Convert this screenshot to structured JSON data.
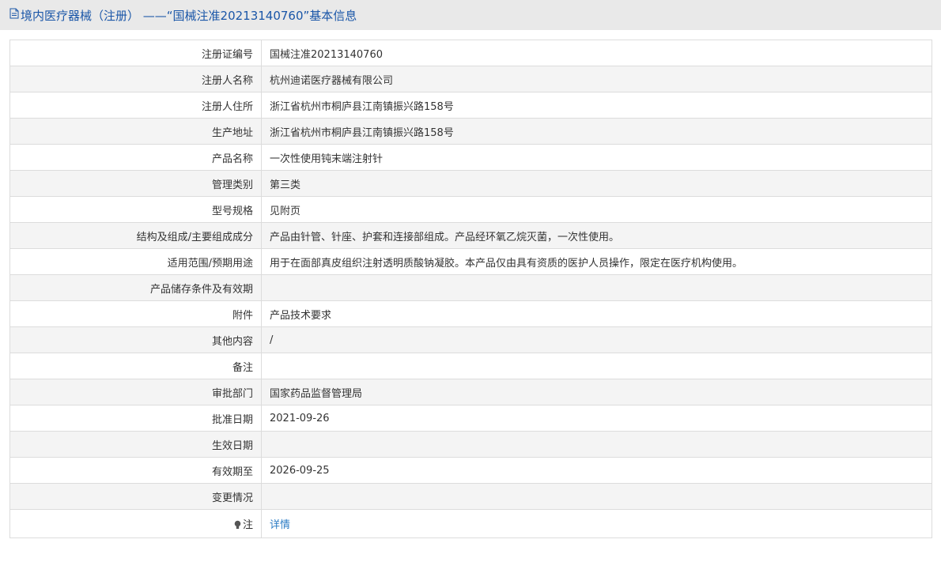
{
  "page": {
    "title": "境内医疗器械（注册） ——“国械注准20213140760”基本信息"
  },
  "rows": [
    {
      "label": "注册证编号",
      "value": "国械注准20213140760"
    },
    {
      "label": "注册人名称",
      "value": "杭州迪诺医疗器械有限公司"
    },
    {
      "label": "注册人住所",
      "value": "浙江省杭州市桐庐县江南镇振兴路158号"
    },
    {
      "label": "生产地址",
      "value": "浙江省杭州市桐庐县江南镇振兴路158号"
    },
    {
      "label": "产品名称",
      "value": "一次性使用钝末端注射针"
    },
    {
      "label": "管理类别",
      "value": "第三类"
    },
    {
      "label": "型号规格",
      "value": "见附页"
    },
    {
      "label": "结构及组成/主要组成成分",
      "value": "产品由针管、针座、护套和连接部组成。产品经环氧乙烷灭菌，一次性使用。"
    },
    {
      "label": "适用范围/预期用途",
      "value": "用于在面部真皮组织注射透明质酸钠凝胶。本产品仅由具有资质的医护人员操作，限定在医疗机构使用。"
    },
    {
      "label": "产品储存条件及有效期",
      "value": ""
    },
    {
      "label": "附件",
      "value": "产品技术要求"
    },
    {
      "label": "其他内容",
      "value": "/"
    },
    {
      "label": "备注",
      "value": ""
    },
    {
      "label": "审批部门",
      "value": "国家药品监督管理局"
    },
    {
      "label": "批准日期",
      "value": "2021-09-26"
    },
    {
      "label": "生效日期",
      "value": ""
    },
    {
      "label": "有效期至",
      "value": "2026-09-25"
    },
    {
      "label": "变更情况",
      "value": ""
    }
  ],
  "note": {
    "label": "注",
    "link": "详情"
  },
  "icons": {
    "title": "document-icon",
    "note": "lightbulb-icon"
  },
  "colors": {
    "title": "#1a56a8",
    "link": "#2b7cc4",
    "border": "#dcdcdc",
    "header_bg": "#e9e9e9"
  }
}
